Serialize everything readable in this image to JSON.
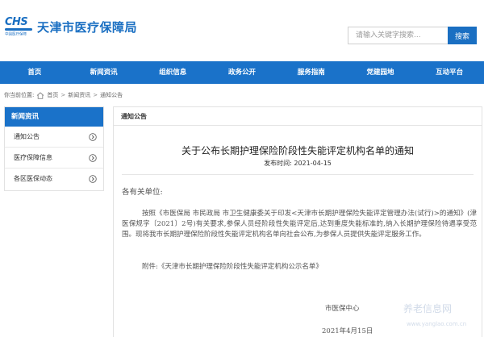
{
  "header": {
    "logo_text": "CHS",
    "logo_subtitle": "中国医疗保障",
    "site_title": "天津市医疗保障局",
    "search_placeholder": "请输入关键字搜索...",
    "search_button": "搜索",
    "brand_color": "#1a6fc2"
  },
  "nav": {
    "items": [
      "首页",
      "新闻资讯",
      "组织信息",
      "政务公开",
      "服务指南",
      "党建园地",
      "互动平台"
    ]
  },
  "breadcrumb": {
    "prefix": "你当前位置:",
    "items": [
      "首页",
      "新闻资讯",
      "通知公告"
    ],
    "separator": ">"
  },
  "sidebar": {
    "title": "新闻资讯",
    "items": [
      "通知公告",
      "医疗保障信息",
      "各区医保动态"
    ]
  },
  "article": {
    "tab_label": "通知公告",
    "title": "关于公布长期护理保险阶段性失能评定机构名单的通知",
    "publish_label": "发布时间:",
    "publish_date": "2021-04-15",
    "salutation": "各有关单位:",
    "body": "按照《市医保局 市民政局 市卫生健康委关于印发<天津市长期护理保险失能评定管理办法(试行)>的通知》(津医保规字〔2021〕2号)有关要求,参保人员经阶段性失能评定后,达到重度失能标准的,纳入长期护理保险待遇享受范围。现将我市长期护理保险阶段性失能评定机构名单向社会公布,为参保人员提供失能评定服务工作。",
    "attachment": "附件:《天津市长期护理保险阶段性失能评定机构公示名单》",
    "signature": "市医保中心",
    "date": "2021年4月15日"
  },
  "watermark": {
    "text": "养老信息网",
    "url": "www.yanglao.com.cn"
  }
}
